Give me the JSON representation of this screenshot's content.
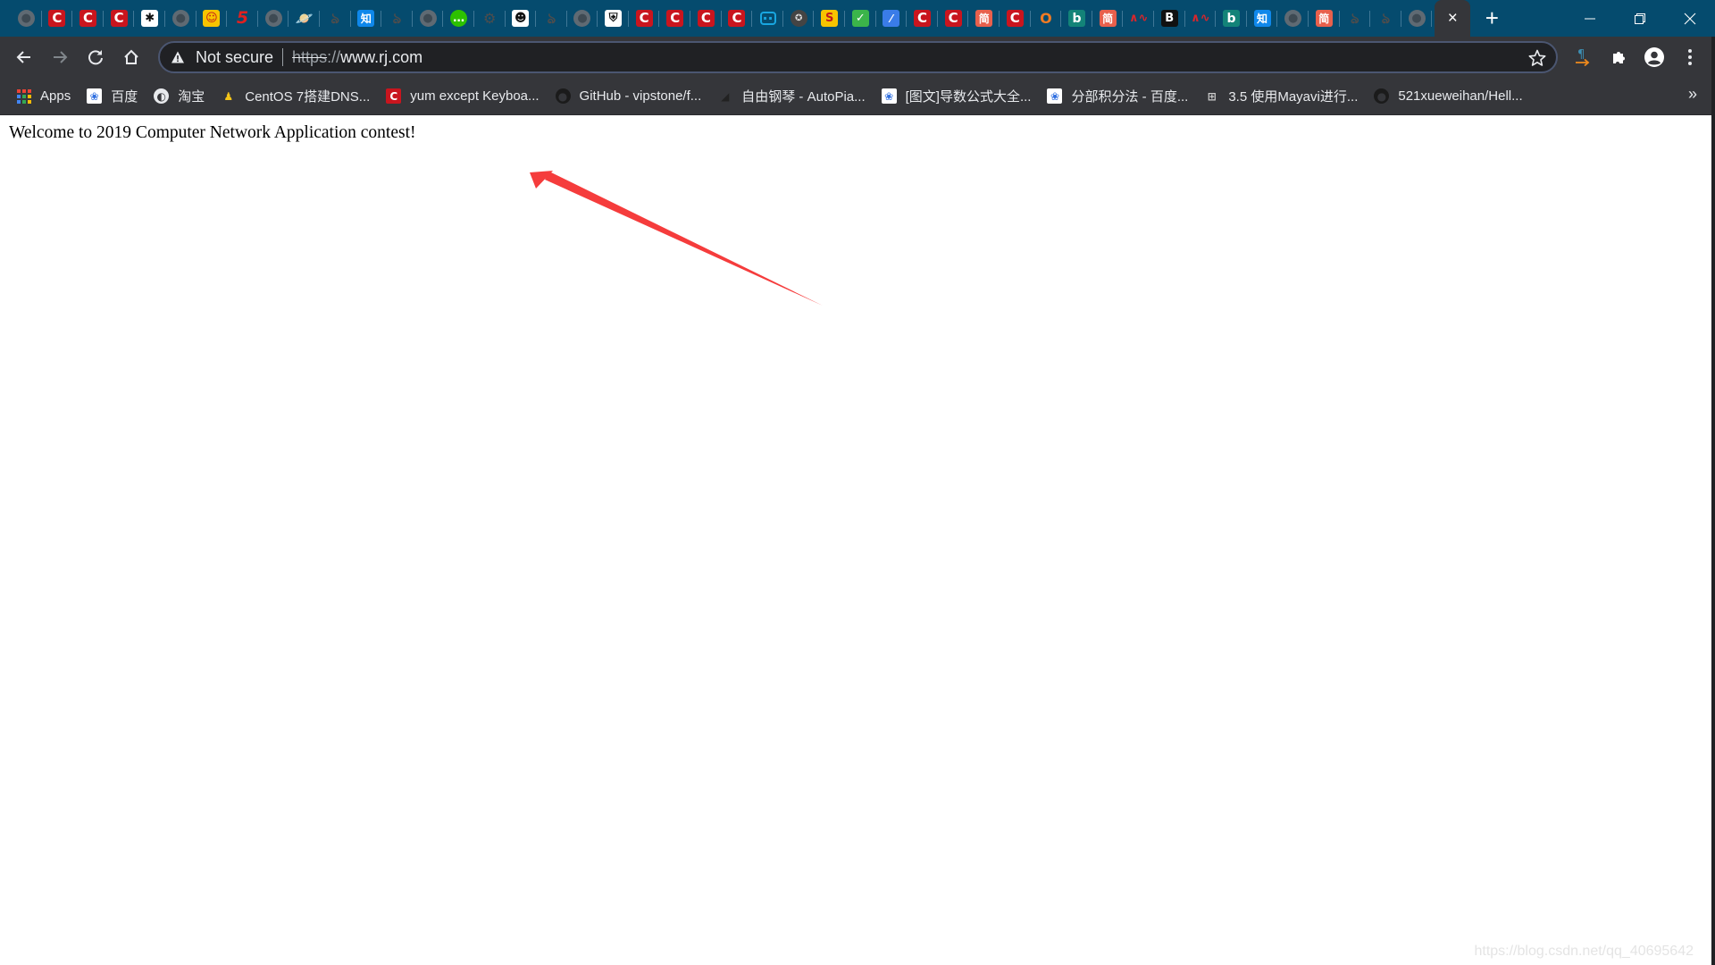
{
  "browser": {
    "pinned_tabs": [
      {
        "icon": "globe-icon",
        "style": "globe",
        "glyph": "●"
      },
      {
        "icon": "csdn-icon",
        "style": "csdn",
        "glyph": "C"
      },
      {
        "icon": "csdn-icon",
        "style": "csdn",
        "glyph": "C"
      },
      {
        "icon": "csdn-icon",
        "style": "csdn",
        "glyph": "C"
      },
      {
        "icon": "bat-icon",
        "style": "white",
        "glyph": "✱"
      },
      {
        "icon": "globe-icon",
        "style": "globe",
        "glyph": "●"
      },
      {
        "icon": "robot-icon",
        "style": "yellow",
        "glyph": "☺"
      },
      {
        "icon": "red-five-icon",
        "style": "red5",
        "glyph": "5"
      },
      {
        "icon": "globe-icon",
        "style": "globe",
        "glyph": "●"
      },
      {
        "icon": "planet-icon",
        "style": "plain",
        "glyph": "🪐"
      },
      {
        "icon": "script-icon",
        "style": "plain",
        "glyph": "ঌ"
      },
      {
        "icon": "zhihu-icon",
        "style": "zhi",
        "glyph": "知"
      },
      {
        "icon": "script-icon",
        "style": "plain",
        "glyph": "ঌ"
      },
      {
        "icon": "globe-icon",
        "style": "globe",
        "glyph": "●"
      },
      {
        "icon": "wechat-icon",
        "style": "wechat",
        "glyph": "…"
      },
      {
        "icon": "gear-flask-icon",
        "style": "plain",
        "glyph": "⚙"
      },
      {
        "icon": "panda-icon",
        "style": "white",
        "glyph": "☻"
      },
      {
        "icon": "script-icon",
        "style": "plain",
        "glyph": "ঌ"
      },
      {
        "icon": "globe-icon",
        "style": "globe",
        "glyph": "●"
      },
      {
        "icon": "shield-icon",
        "style": "white",
        "glyph": "⛨"
      },
      {
        "icon": "csdn-icon",
        "style": "csdn",
        "glyph": "C"
      },
      {
        "icon": "csdn-icon",
        "style": "csdn",
        "glyph": "C"
      },
      {
        "icon": "csdn-icon",
        "style": "csdn",
        "glyph": "C"
      },
      {
        "icon": "csdn-icon",
        "style": "csdn",
        "glyph": "C"
      },
      {
        "icon": "bilibili-icon",
        "style": "bili",
        "glyph": "··"
      },
      {
        "icon": "badge-icon",
        "style": "dark-round",
        "glyph": "✪"
      },
      {
        "icon": "s-logo-icon",
        "style": "yellow",
        "glyph": "S"
      },
      {
        "icon": "checkmark-icon",
        "style": "check",
        "glyph": "✓"
      },
      {
        "icon": "feather-icon",
        "style": "feather",
        "glyph": "⁄"
      },
      {
        "icon": "csdn-icon",
        "style": "csdn",
        "glyph": "C"
      },
      {
        "icon": "csdn-icon",
        "style": "csdn",
        "glyph": "C"
      },
      {
        "icon": "jianshu-icon",
        "style": "jian",
        "glyph": "简"
      },
      {
        "icon": "csdn-icon",
        "style": "csdn",
        "glyph": "C"
      },
      {
        "icon": "orange-icon",
        "style": "orange-o",
        "glyph": "O"
      },
      {
        "icon": "bing-icon",
        "style": "bing",
        "glyph": "b"
      },
      {
        "icon": "jianshu-icon",
        "style": "jian",
        "glyph": "简"
      },
      {
        "icon": "wave-icon",
        "style": "wave",
        "glyph": "∧∿"
      },
      {
        "icon": "bootstrap-icon",
        "style": "bold-b",
        "glyph": "B"
      },
      {
        "icon": "wave-icon",
        "style": "wave",
        "glyph": "∧∿"
      },
      {
        "icon": "bing-icon",
        "style": "bing",
        "glyph": "b"
      },
      {
        "icon": "zhihu-icon",
        "style": "zhi",
        "glyph": "知"
      },
      {
        "icon": "globe-icon",
        "style": "globe",
        "glyph": "●"
      },
      {
        "icon": "jianshu-icon",
        "style": "jian",
        "glyph": "简"
      },
      {
        "icon": "script-icon",
        "style": "plain",
        "glyph": "ঌ"
      },
      {
        "icon": "script-icon",
        "style": "plain",
        "glyph": "ঌ"
      },
      {
        "icon": "globe-icon",
        "style": "globe",
        "glyph": "●"
      }
    ],
    "active_tab_close": "×",
    "new_tab": "+",
    "window_controls": {
      "minimize": "minimize",
      "restore": "restore",
      "close": "close"
    }
  },
  "toolbar": {
    "security_label": "Not secure",
    "url_scheme": "https",
    "url_sep": "://",
    "url_host": "www.rj.com"
  },
  "bookmarks": [
    {
      "label": "Apps",
      "icon": "apps-grid-icon"
    },
    {
      "label": "百度",
      "icon": "baidu-paw-icon"
    },
    {
      "label": "淘宝",
      "icon": "globe-icon"
    },
    {
      "label": "CentOS 7搭建DNS...",
      "icon": "tux-penguin-icon"
    },
    {
      "label": "yum except Keyboa...",
      "icon": "csdn-icon"
    },
    {
      "label": "GitHub - vipstone/f...",
      "icon": "github-icon"
    },
    {
      "label": "自由钢琴 - AutoPia...",
      "icon": "piano-icon"
    },
    {
      "label": "[图文]导数公式大全...",
      "icon": "baidu-paw-icon"
    },
    {
      "label": "分部积分法 - 百度...",
      "icon": "baidu-paw-icon"
    },
    {
      "label": "3.5 使用Mayavi进行...",
      "icon": "book-icon"
    },
    {
      "label": "521xueweihan/Hell...",
      "icon": "github-icon"
    }
  ],
  "bookmarks_more": "»",
  "page": {
    "welcome_text": "Welcome to 2019 Computer Network Application contest!",
    "annotation_color": "#f53c3c",
    "watermark": "https://blog.csdn.net/qq_40695642"
  }
}
